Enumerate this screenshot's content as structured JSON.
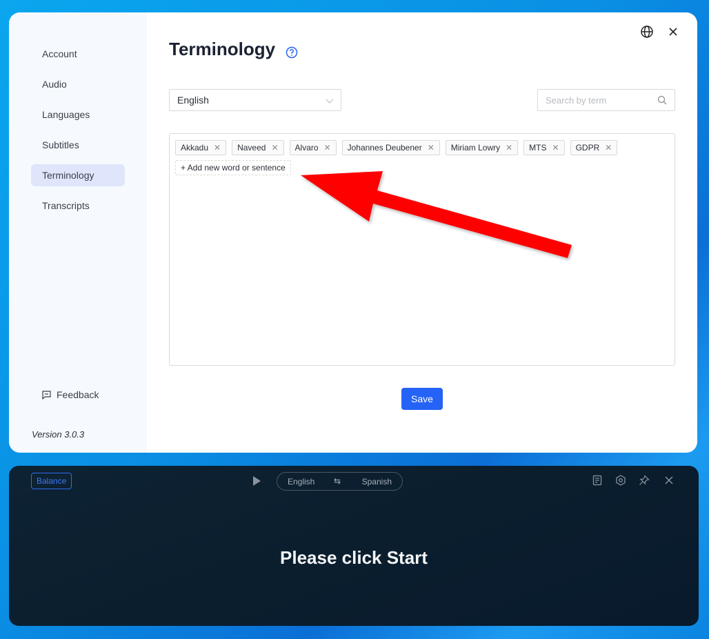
{
  "settings": {
    "sidebar": {
      "items": [
        {
          "label": "Account",
          "active": false
        },
        {
          "label": "Audio",
          "active": false
        },
        {
          "label": "Languages",
          "active": false
        },
        {
          "label": "Subtitles",
          "active": false
        },
        {
          "label": "Terminology",
          "active": true
        },
        {
          "label": "Transcripts",
          "active": false
        }
      ],
      "feedback_label": "Feedback",
      "version": "Version 3.0.3"
    },
    "header": {
      "title": "Terminology",
      "help_icon": "question-circle-icon",
      "globe_icon": "globe-icon",
      "close_icon": "close-icon"
    },
    "language_select": {
      "value": "English"
    },
    "search": {
      "placeholder": "Search by term",
      "value": ""
    },
    "terms": [
      {
        "label": "Akkadu"
      },
      {
        "label": "Naveed"
      },
      {
        "label": "Alvaro"
      },
      {
        "label": "Johannes Deubener"
      },
      {
        "label": "Miriam Lowry"
      },
      {
        "label": "MTS"
      },
      {
        "label": "GDPR"
      }
    ],
    "add_term_label": "+ Add new word or sentence",
    "save_label": "Save"
  },
  "annotation": {
    "arrow_color": "#ff0000"
  },
  "caption_window": {
    "balance_label": "Balance",
    "source_language": "English",
    "swap_glyph": "⇆",
    "target_language": "Spanish",
    "message": "Please click Start",
    "icons": [
      "document-icon",
      "settings-icon",
      "pin-icon",
      "close-icon"
    ]
  },
  "colors": {
    "accent": "#2563f6",
    "active_nav": "#dfe6fb",
    "caption_bg": "#0b1e2e"
  }
}
